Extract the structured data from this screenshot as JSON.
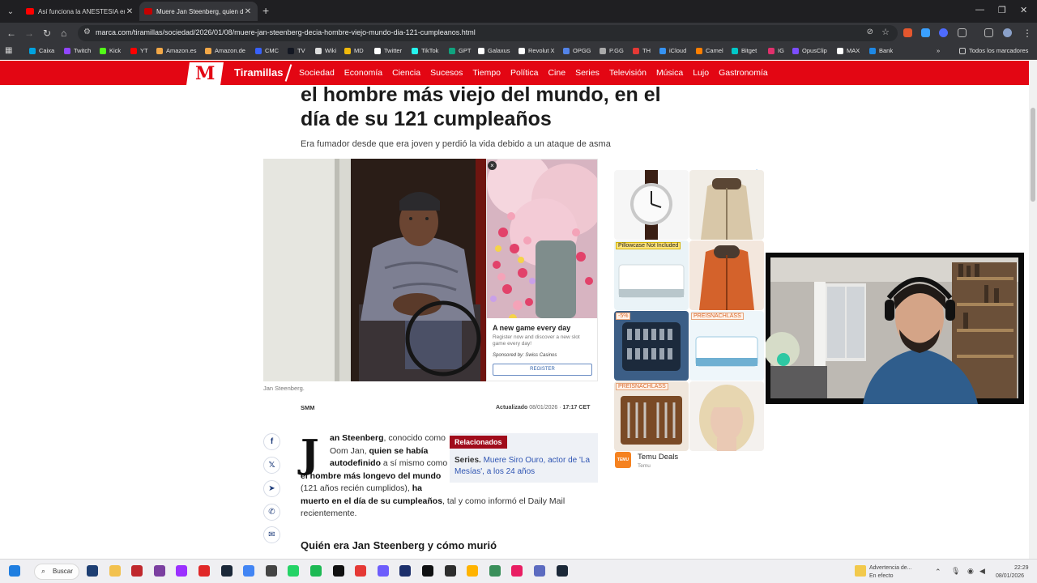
{
  "browser": {
    "tabs": [
      {
        "label": "Así funciona la ANESTESIA en el",
        "active": false,
        "favicon_color": "#ff0000"
      },
      {
        "label": "Muere Jan Steenberg, quien de",
        "active": true,
        "favicon_color": "#c40000"
      }
    ],
    "new_tab": "+",
    "url": "marca.com/tiramillas/sociedad/2026/01/08/muere-jan-steenberg-decia-hombre-viejo-mundo-dia-121-cumpleanos.html",
    "bookmarks": [
      {
        "label": "Caixa",
        "color": "#00a3e0"
      },
      {
        "label": "Twitch",
        "color": "#9146ff"
      },
      {
        "label": "Kick",
        "color": "#53fc18"
      },
      {
        "label": "YT",
        "color": "#ff0000"
      },
      {
        "label": "Amazon.es",
        "color": "#f3a847"
      },
      {
        "label": "Amazon.de",
        "color": "#f3a847"
      },
      {
        "label": "CMC",
        "color": "#3861fb"
      },
      {
        "label": "TV",
        "color": "#131722"
      },
      {
        "label": "Wiki",
        "color": "#dddddd"
      },
      {
        "label": "MD",
        "color": "#f0b90b"
      },
      {
        "label": "Twitter",
        "color": "#ffffff"
      },
      {
        "label": "TikTok",
        "color": "#25f4ee"
      },
      {
        "label": "GPT",
        "color": "#10a37f"
      },
      {
        "label": "Galaxus",
        "color": "#ffffff"
      },
      {
        "label": "Revolut X",
        "color": "#ffffff"
      },
      {
        "label": "OPGG",
        "color": "#5383e8"
      },
      {
        "label": "P.GG",
        "color": "#aaaaaa"
      },
      {
        "label": "TH",
        "color": "#e53935"
      },
      {
        "label": "iCloud",
        "color": "#3693f3"
      },
      {
        "label": "Camel",
        "color": "#ff7f00"
      },
      {
        "label": "Bitget",
        "color": "#00c8c8"
      },
      {
        "label": "IG",
        "color": "#e1306c"
      },
      {
        "label": "OpusClip",
        "color": "#7c4dff"
      },
      {
        "label": "MAX",
        "color": "#ffffff"
      },
      {
        "label": "Bank",
        "color": "#1e88e5"
      }
    ],
    "bookmarks_overflow": "»",
    "all_bookmarks": "Todos los marcadores"
  },
  "site": {
    "logo": "M",
    "section": "Tiramillas",
    "nav": [
      "Sociedad",
      "Economía",
      "Ciencia",
      "Sucesos",
      "Tiempo",
      "Política",
      "Cine",
      "Series",
      "Televisión",
      "Música",
      "Lujo",
      "Gastronomía"
    ],
    "brand_color": "#e30613"
  },
  "article": {
    "headline": "el hombre más viejo del mundo, en el día de su 121 cumpleaños",
    "subheadline": "Era fumador desde que era joven y perdió la vida debido a un ataque de asma",
    "photo_caption": "Jan Steenberg.",
    "author": "SMM",
    "updated_label": "Actualizado",
    "updated_date": "08/01/2026",
    "updated_time": "17:17",
    "updated_tz": "CET",
    "dropcap": "J",
    "p1": [
      {
        "t": "an Steenberg",
        "b": true
      },
      {
        "t": ", conocido como Oom Jan, ",
        "b": false
      },
      {
        "t": "quien se había autodefinido",
        "b": true
      },
      {
        "t": " a sí mismo como ",
        "b": false
      },
      {
        "t": "el hombre más longevo del mundo",
        "b": true
      },
      {
        "t": " (121 años recién cumplidos), ",
        "b": false
      },
      {
        "t": "ha muerto en el día de su cumpleaños",
        "b": true
      },
      {
        "t": ", tal y como informó el Daily Mail recientemente.",
        "b": false
      }
    ],
    "related_label": "Relacionados",
    "related_prefix": "Series.",
    "related_link": "Muere Siro Ouro, actor de 'La Mesías', a los 24 años",
    "section_heading": "Quién era Jan Steenberg y cómo murió"
  },
  "share": [
    {
      "name": "facebook",
      "glyph": "f"
    },
    {
      "name": "twitter",
      "glyph": "𝕏"
    },
    {
      "name": "telegram",
      "glyph": "➤"
    },
    {
      "name": "whatsapp",
      "glyph": "✆"
    },
    {
      "name": "email",
      "glyph": "✉"
    }
  ],
  "ad_game": {
    "title": "A new game every day",
    "body": "Register now and discover a new slot game every day!",
    "sponsor": "Sponsored by: Swiss Casinos",
    "button": "REGISTER",
    "close": "×"
  },
  "ad_temu": {
    "badge_sale": "-5%",
    "badge_1": "PREISNACHLASS",
    "badge_2": "PREISNACHLASS",
    "warning": "Pillowcase Not Included",
    "brand_tile": "TEMU",
    "advertiser": "Temu Deals",
    "advertiser_sub": "Temu"
  },
  "taskbar": {
    "search": "Buscar",
    "notice_title": "Advertencia de...",
    "notice_sub": "En efecto",
    "time": "22:29",
    "date": "08/01/2026"
  }
}
